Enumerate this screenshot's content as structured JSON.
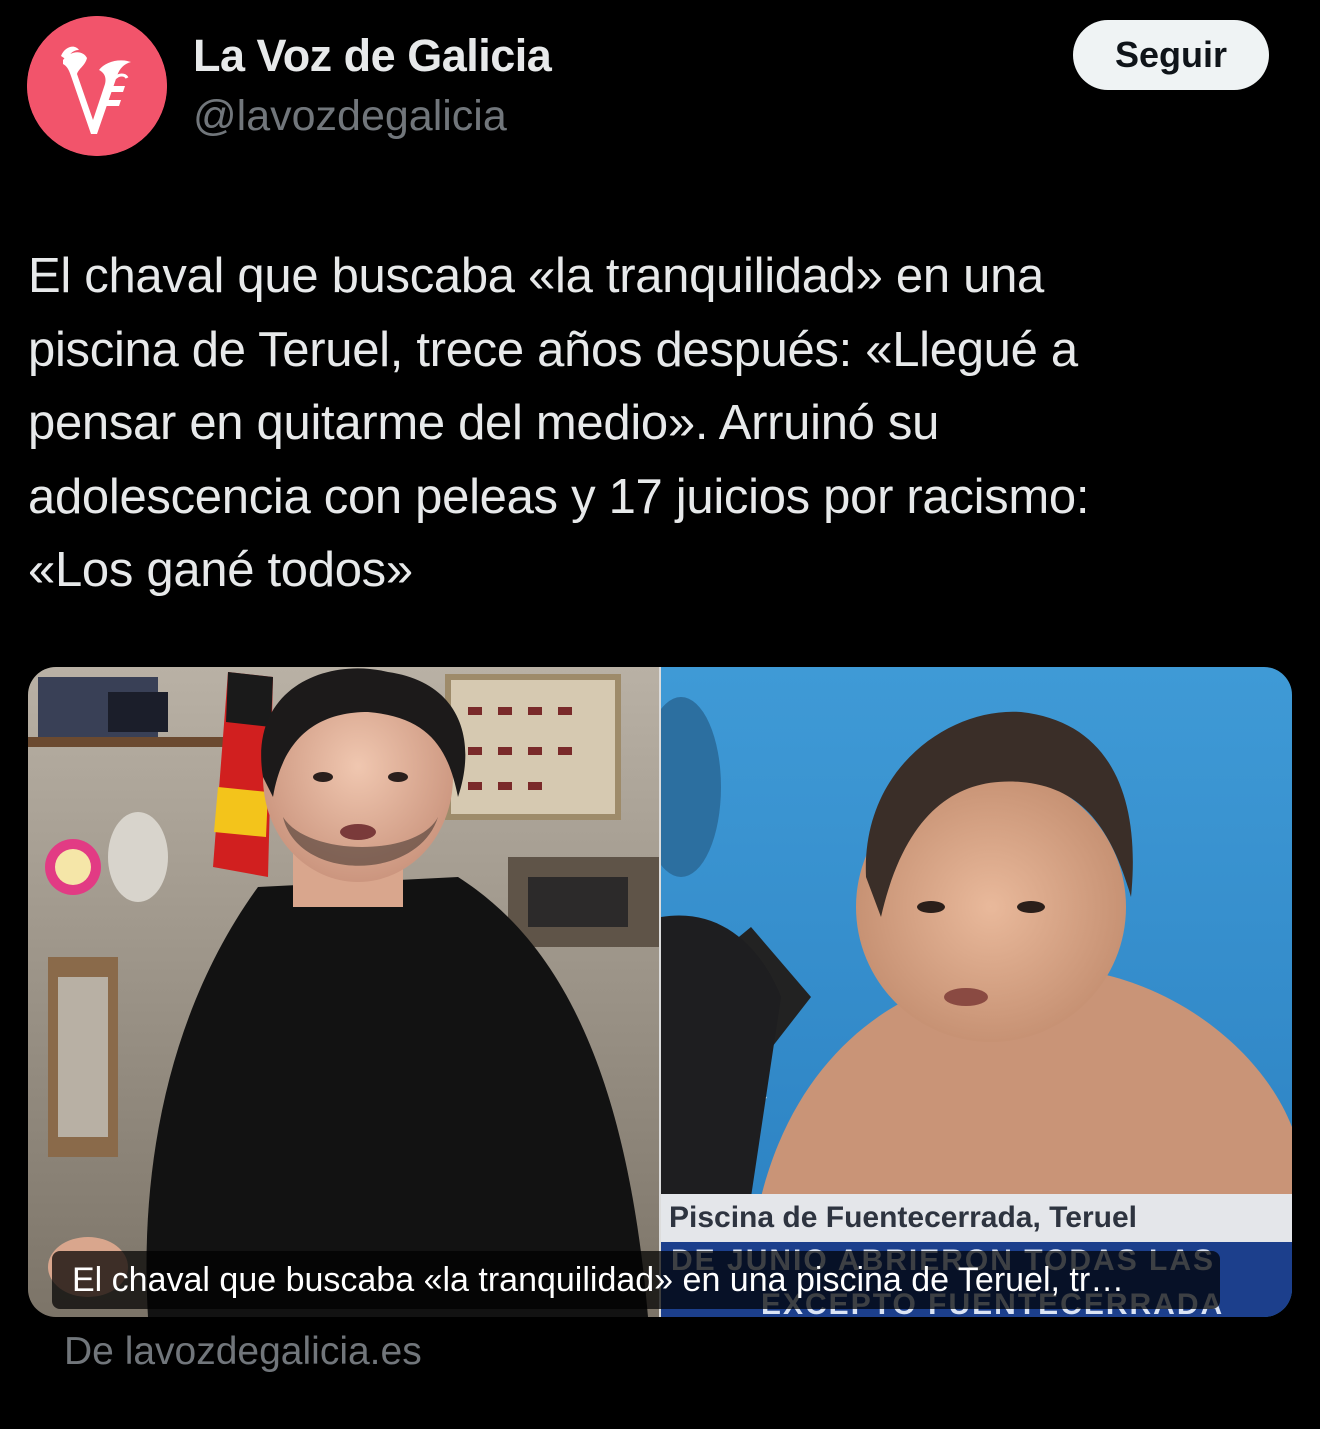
{
  "account": {
    "display_name": "La Voz de Galicia",
    "handle": "@lavozdegalicia",
    "avatar_icon": "gothic-v-logo-icon",
    "avatar_color": "#f2546b"
  },
  "follow_button": {
    "label": "Seguir"
  },
  "tweet": {
    "lines": [
      "El chaval que buscaba «la tranquilidad» en una",
      "piscina de Teruel, trece años después: «Llegué a",
      "pensar en quitarme del medio». Arruinó su",
      "adolescencia con peleas y 17 juicios por racismo:",
      "«Los gané todos»"
    ]
  },
  "media": {
    "left_photo": "young man in black t-shirt seated in a room with shelves of toy cars and a flag",
    "right_photo": "teenage boy in swimming pool speaking into TV microphone",
    "tv_lower_third": "Piscina de Fuentecerrada, Teruel",
    "tv_ticker_line_1": "DE JUNIO ABRIERON TODAS LAS",
    "tv_ticker_line_2": "EXCEPTO FUENTECERRADA",
    "caption": "El chaval que buscaba «la tranquilidad» en una piscina de Teruel, tr…"
  },
  "source": {
    "label": "De lavozdegalicia.es"
  },
  "colors": {
    "background": "#000000",
    "primary_text": "#e7e9ea",
    "secondary_text": "#71767b",
    "button_bg": "#eff3f4"
  }
}
